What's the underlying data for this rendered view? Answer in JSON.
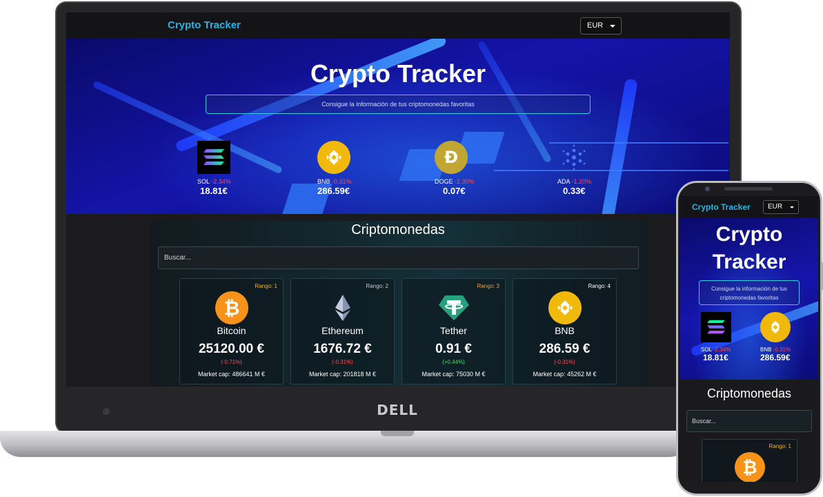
{
  "navbar": {
    "brand": "Crypto Tracker",
    "currency": "EUR"
  },
  "hero": {
    "title": "Crypto Tracker",
    "subtitle": "Consigue la información de tus criptomonedas favoritas",
    "trending": [
      {
        "symbol": "SOL",
        "change": "-2.34%",
        "price": "18.81€",
        "icon": "solana-icon"
      },
      {
        "symbol": "BNB",
        "change": "-0.31%",
        "price": "286.59€",
        "icon": "bnb-icon"
      },
      {
        "symbol": "DOGE",
        "change": "-2.30%",
        "price": "0.07€",
        "icon": "dogecoin-icon"
      },
      {
        "symbol": "ADA",
        "change": "-1.20%",
        "price": "0.33€",
        "icon": "cardano-icon"
      }
    ]
  },
  "section": {
    "title": "Criptomonedas",
    "search_placeholder": "Buscar..."
  },
  "cards": [
    {
      "rank": "Rango: 1",
      "name": "Bitcoin",
      "price": "25120.00 €",
      "change": "(-0.71%)",
      "market_cap": "Market cap: 486641 M €",
      "icon": "bitcoin-icon",
      "rank_color": "#f0b90b",
      "change_color": "#ff4d4d"
    },
    {
      "rank": "Rango: 2",
      "name": "Ethereum",
      "price": "1676.72 €",
      "change": "(-0.31%)",
      "market_cap": "Market cap: 201818 M €",
      "icon": "ethereum-icon",
      "rank_color": "#c8c8c8",
      "change_color": "#ff4d4d"
    },
    {
      "rank": "Rango: 3",
      "name": "Tether",
      "price": "0.91 €",
      "change": "(+0.44%)",
      "market_cap": "Market cap: 75030 M €",
      "icon": "tether-icon",
      "rank_color": "#e8a23a",
      "change_color": "#3ddc6b"
    },
    {
      "rank": "Rango: 4",
      "name": "BNB",
      "price": "286.59 €",
      "change": "(-0.31%)",
      "market_cap": "Market cap: 45262 M €",
      "icon": "bnb-icon",
      "rank_color": "#ffffff",
      "change_color": "#ff4d4d"
    }
  ],
  "laptop": {
    "logo": "DELL"
  },
  "phone": {
    "brand": "Crypto Tracker",
    "currency": "EUR",
    "title_line1": "Crypto",
    "title_line2": "Tracker",
    "subtitle": "Consigue la información de tus criptomonedas favoritas",
    "trending": [
      {
        "symbol": "SOL",
        "change": "-2.34%",
        "price": "18.81€"
      },
      {
        "symbol": "BNB",
        "change": "-0.31%",
        "price": "286.59€"
      }
    ],
    "section_title": "Criptomonedas",
    "search_placeholder": "Buscar...",
    "card_rank": "Rango: 1"
  },
  "colors": {
    "accent": "#27b2e6",
    "negative": "#ff4d4d",
    "positive": "#3ddc6b",
    "bitcoin": "#f7931a",
    "bnb": "#f0b90b",
    "tether": "#26a17b"
  }
}
